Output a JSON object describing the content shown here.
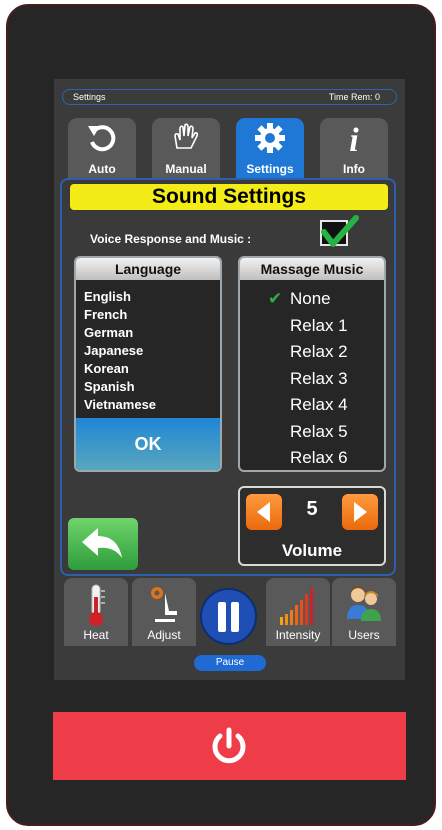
{
  "status": {
    "screen": "Settings",
    "time_remaining": "Time Rem: 0"
  },
  "tabs": [
    {
      "label": "Auto",
      "icon": "refresh-icon"
    },
    {
      "label": "Manual",
      "icon": "hand-icon"
    },
    {
      "label": "Settings",
      "icon": "gear-icon",
      "active": true
    },
    {
      "label": "Info",
      "icon": "info-icon"
    }
  ],
  "sound": {
    "title": "Sound Settings",
    "voice_label": "Voice Response and Music :",
    "voice_checked": true,
    "language": {
      "header": "Language",
      "items": [
        "English",
        "French",
        "German",
        "Japanese",
        "Korean",
        "Spanish",
        "Vietnamese"
      ],
      "ok_label": "OK"
    },
    "music": {
      "header": "Massage Music",
      "items": [
        "None",
        "Relax 1",
        "Relax 2",
        "Relax 3",
        "Relax 4",
        "Relax 5",
        "Relax 6"
      ],
      "selected": "None"
    },
    "volume": {
      "value": "5",
      "label": "Volume"
    }
  },
  "bottom": {
    "heat": "Heat",
    "adjust": "Adjust",
    "intensity": "Intensity",
    "users": "Users",
    "pause": "Pause"
  },
  "colors": {
    "accent_blue": "#1f78d6",
    "title_yellow": "#f3ec17",
    "power_red": "#ee3d49",
    "volume_orange": "#ff8a24"
  }
}
